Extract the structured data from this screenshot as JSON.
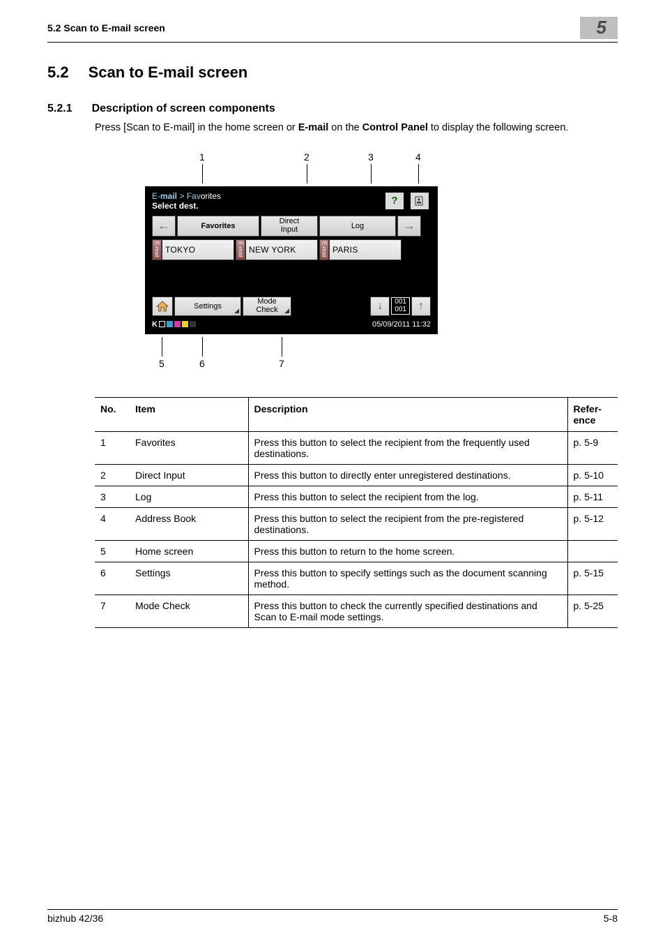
{
  "header": {
    "running": "5.2    Scan to E-mail screen",
    "chapter_num": "5"
  },
  "h2": {
    "num": "5.2",
    "title": "Scan to E-mail screen"
  },
  "h3": {
    "num": "5.2.1",
    "title": "Description of screen components"
  },
  "intro": {
    "pre": "Press [Scan to E-mail] in the home screen or ",
    "b1": "E-mail",
    "mid": " on the ",
    "b2": "Control Panel",
    "post": " to display the following screen."
  },
  "callouts": {
    "c1": "1",
    "c2": "2",
    "c3": "3",
    "c4": "4",
    "c5": "5",
    "c6": "6",
    "c7": "7"
  },
  "screen": {
    "crumb1": "E-",
    "crumb_bold": "mail",
    "crumb2": " > Fav",
    "crumb3": "orites",
    "sub": "Select dest.",
    "help_icon": "?",
    "book_icon": "addr",
    "arrow_left": "←",
    "arrow_right": "→",
    "tabs": {
      "favorites": "Favorites",
      "direct": "Direct\nInput",
      "log": "Log"
    },
    "dests": [
      {
        "tag": "E-mail",
        "label": "TOKYO"
      },
      {
        "tag": "E-mail",
        "label": "NEW YORK"
      },
      {
        "tag": "E-mail",
        "label": "PARIS"
      }
    ],
    "settings_label": "Settings",
    "mode_label": "Mode\nCheck",
    "page_up": "↓",
    "page_down": "↑",
    "page_count": "001\n001",
    "toner_label": "K",
    "timestamp": "05/09/2011  11:32"
  },
  "table": {
    "head": {
      "no": "No.",
      "item": "Item",
      "desc": "Description",
      "ref": "Refer-\nence"
    },
    "rows": [
      {
        "no": "1",
        "item": "Favorites",
        "desc": "Press this button to select the recipient from the frequently used destinations.",
        "ref": "p. 5-9"
      },
      {
        "no": "2",
        "item": "Direct Input",
        "desc": "Press this button to directly enter unregistered destinations.",
        "ref": "p. 5-10"
      },
      {
        "no": "3",
        "item": "Log",
        "desc": "Press this button to select the recipient from the log.",
        "ref": "p. 5-11"
      },
      {
        "no": "4",
        "item": "Address Book",
        "desc": "Press this button to select the recipient from the pre-registered destinations.",
        "ref": "p. 5-12"
      },
      {
        "no": "5",
        "item": "Home screen",
        "desc": "Press this button to return to the home screen.",
        "ref": ""
      },
      {
        "no": "6",
        "item": "Settings",
        "desc": "Press this button to specify settings such as the document scanning method.",
        "ref": "p. 5-15"
      },
      {
        "no": "7",
        "item": "Mode Check",
        "desc": "Press this button to check the currently specified destinations and Scan to E-mail mode settings.",
        "ref": "p. 5-25"
      }
    ]
  },
  "footer": {
    "model": "bizhub 42/36",
    "page": "5-8"
  }
}
